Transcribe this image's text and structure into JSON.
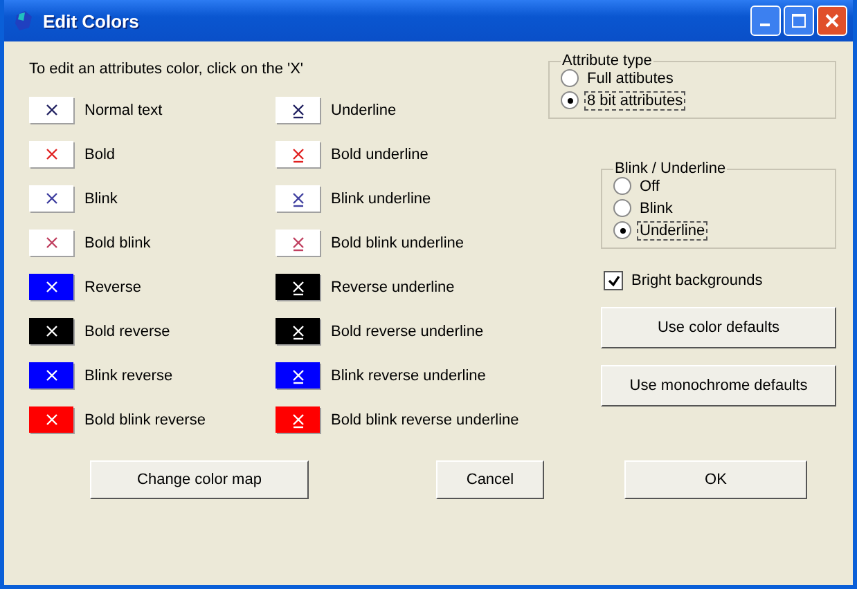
{
  "window": {
    "title": "Edit Colors"
  },
  "instruction": "To edit an attributes color, click on the 'X'",
  "attributes": [
    {
      "label": "Normal text",
      "color": "#ffffff",
      "kind": "normal",
      "underlined": false
    },
    {
      "label": "Underline",
      "color": "#ffffff",
      "kind": "normal",
      "underlined": true
    },
    {
      "label": "Bold",
      "color": "#ffffff",
      "kind": "bold",
      "underlined": false
    },
    {
      "label": "Bold underline",
      "color": "#ffffff",
      "kind": "bold",
      "underlined": true
    },
    {
      "label": "Blink",
      "color": "#ffffff",
      "kind": "blink",
      "underlined": false
    },
    {
      "label": "Blink underline",
      "color": "#ffffff",
      "kind": "blink",
      "underlined": true
    },
    {
      "label": "Bold blink",
      "color": "#ffffff",
      "kind": "boldblink",
      "underlined": false
    },
    {
      "label": "Bold blink underline",
      "color": "#ffffff",
      "kind": "boldblink",
      "underlined": true
    },
    {
      "label": "Reverse",
      "color": "#0000ff",
      "kind": "reverse",
      "underlined": false
    },
    {
      "label": "Reverse underline",
      "color": "#000000",
      "kind": "reverse",
      "underlined": true
    },
    {
      "label": "Bold reverse",
      "color": "#000000",
      "kind": "reverse",
      "underlined": false
    },
    {
      "label": "Bold reverse underline",
      "color": "#000000",
      "kind": "reverse",
      "underlined": true
    },
    {
      "label": "Blink reverse",
      "color": "#0000ff",
      "kind": "reverse",
      "underlined": false
    },
    {
      "label": "Blink reverse underline",
      "color": "#0000ff",
      "kind": "reverse",
      "underlined": true
    },
    {
      "label": "Bold blink reverse",
      "color": "#ff0000",
      "kind": "reverse",
      "underlined": false
    },
    {
      "label": "Bold blink reverse underline",
      "color": "#ff0000",
      "kind": "reverse",
      "underlined": true
    }
  ],
  "attribute_type": {
    "title": "Attribute type",
    "options": [
      {
        "label": "Full attibutes",
        "selected": false
      },
      {
        "label": "8 bit attributes",
        "selected": true
      }
    ]
  },
  "blink_underline": {
    "title": "Blink / Underline",
    "options": [
      {
        "label": "Off",
        "selected": false
      },
      {
        "label": "Blink",
        "selected": false
      },
      {
        "label": "Underline",
        "selected": true
      }
    ]
  },
  "bright_backgrounds": {
    "label": "Bright backgrounds",
    "checked": true
  },
  "side_buttons": [
    "Use color defaults",
    "Use monochrome defaults"
  ],
  "bottom_buttons": [
    "Change color map",
    "Cancel",
    "OK"
  ]
}
